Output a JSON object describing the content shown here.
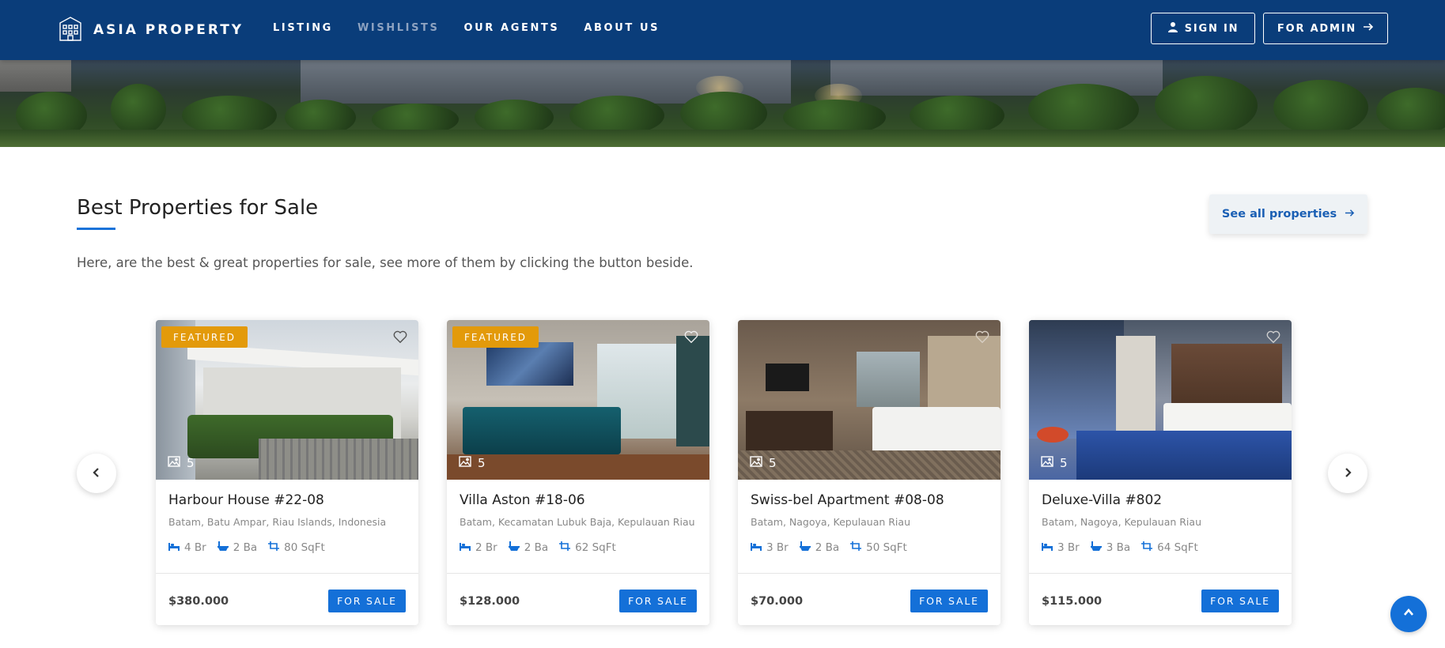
{
  "header": {
    "brand": "ASIA PROPERTY",
    "nav": [
      {
        "label": "LISTING"
      },
      {
        "label": "WISHLISTS"
      },
      {
        "label": "OUR AGENTS"
      },
      {
        "label": "ABOUT US"
      }
    ],
    "signin_label": "SIGN IN",
    "admin_label": "FOR ADMIN"
  },
  "section": {
    "title": "Best Properties for Sale",
    "description": "Here, are the best & great properties for sale, see more of them by clicking the button beside.",
    "see_all_label": "See all properties"
  },
  "listings": [
    {
      "featured": "FEATURED",
      "image_count": "5",
      "title": "Harbour House #22-08",
      "location": "Batam, Batu Ampar, Riau Islands, Indonesia",
      "beds": "4 Br",
      "baths": "2 Ba",
      "area": "80 SqFt",
      "price": "$380.000",
      "status": "FOR SALE"
    },
    {
      "featured": "FEATURED",
      "image_count": "5",
      "title": "Villa Aston #18-06",
      "location": "Batam, Kecamatan Lubuk Baja, Kepulauan Riau",
      "beds": "2 Br",
      "baths": "2 Ba",
      "area": "62 SqFt",
      "price": "$128.000",
      "status": "FOR SALE"
    },
    {
      "image_count": "5",
      "title": "Swiss-bel Apartment #08-08",
      "location": "Batam, Nagoya, Kepulauan Riau",
      "beds": "3 Br",
      "baths": "2 Ba",
      "area": "50 SqFt",
      "price": "$70.000",
      "status": "FOR SALE"
    },
    {
      "image_count": "5",
      "title": "Deluxe-Villa #802",
      "location": "Batam, Nagoya, Kepulauan Riau",
      "beds": "3 Br",
      "baths": "3 Ba",
      "area": "64 SqFt",
      "price": "$115.000",
      "status": "FOR SALE"
    }
  ],
  "icons": [
    "building-logo-icon",
    "user-icon",
    "arrow-right-icon",
    "chevron-left-icon",
    "chevron-right-icon",
    "heart-icon",
    "image-icon",
    "bed-icon",
    "bath-icon",
    "area-icon",
    "chevron-up-icon"
  ],
  "colors": {
    "header_bg": "#0a3d7a",
    "accent": "#1470d8",
    "featured": "#e39a0a"
  }
}
